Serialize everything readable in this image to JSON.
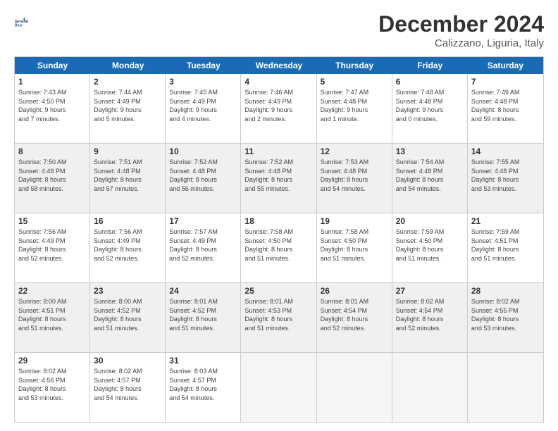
{
  "header": {
    "logo_general": "General",
    "logo_blue": "Blue",
    "month_title": "December 2024",
    "location": "Calizzano, Liguria, Italy"
  },
  "weekdays": [
    "Sunday",
    "Monday",
    "Tuesday",
    "Wednesday",
    "Thursday",
    "Friday",
    "Saturday"
  ],
  "weeks": [
    [
      {
        "day": "1",
        "info": "Sunrise: 7:43 AM\nSunset: 4:50 PM\nDaylight: 9 hours\nand 7 minutes.",
        "empty": false,
        "shaded": false
      },
      {
        "day": "2",
        "info": "Sunrise: 7:44 AM\nSunset: 4:49 PM\nDaylight: 9 hours\nand 5 minutes.",
        "empty": false,
        "shaded": false
      },
      {
        "day": "3",
        "info": "Sunrise: 7:45 AM\nSunset: 4:49 PM\nDaylight: 9 hours\nand 4 minutes.",
        "empty": false,
        "shaded": false
      },
      {
        "day": "4",
        "info": "Sunrise: 7:46 AM\nSunset: 4:49 PM\nDaylight: 9 hours\nand 2 minutes.",
        "empty": false,
        "shaded": false
      },
      {
        "day": "5",
        "info": "Sunrise: 7:47 AM\nSunset: 4:48 PM\nDaylight: 9 hours\nand 1 minute.",
        "empty": false,
        "shaded": false
      },
      {
        "day": "6",
        "info": "Sunrise: 7:48 AM\nSunset: 4:48 PM\nDaylight: 9 hours\nand 0 minutes.",
        "empty": false,
        "shaded": false
      },
      {
        "day": "7",
        "info": "Sunrise: 7:49 AM\nSunset: 4:48 PM\nDaylight: 8 hours\nand 59 minutes.",
        "empty": false,
        "shaded": false
      }
    ],
    [
      {
        "day": "8",
        "info": "Sunrise: 7:50 AM\nSunset: 4:48 PM\nDaylight: 8 hours\nand 58 minutes.",
        "empty": false,
        "shaded": true
      },
      {
        "day": "9",
        "info": "Sunrise: 7:51 AM\nSunset: 4:48 PM\nDaylight: 8 hours\nand 57 minutes.",
        "empty": false,
        "shaded": true
      },
      {
        "day": "10",
        "info": "Sunrise: 7:52 AM\nSunset: 4:48 PM\nDaylight: 8 hours\nand 56 minutes.",
        "empty": false,
        "shaded": true
      },
      {
        "day": "11",
        "info": "Sunrise: 7:52 AM\nSunset: 4:48 PM\nDaylight: 8 hours\nand 55 minutes.",
        "empty": false,
        "shaded": true
      },
      {
        "day": "12",
        "info": "Sunrise: 7:53 AM\nSunset: 4:48 PM\nDaylight: 8 hours\nand 54 minutes.",
        "empty": false,
        "shaded": true
      },
      {
        "day": "13",
        "info": "Sunrise: 7:54 AM\nSunset: 4:48 PM\nDaylight: 8 hours\nand 54 minutes.",
        "empty": false,
        "shaded": true
      },
      {
        "day": "14",
        "info": "Sunrise: 7:55 AM\nSunset: 4:48 PM\nDaylight: 8 hours\nand 53 minutes.",
        "empty": false,
        "shaded": true
      }
    ],
    [
      {
        "day": "15",
        "info": "Sunrise: 7:56 AM\nSunset: 4:49 PM\nDaylight: 8 hours\nand 52 minutes.",
        "empty": false,
        "shaded": false
      },
      {
        "day": "16",
        "info": "Sunrise: 7:56 AM\nSunset: 4:49 PM\nDaylight: 8 hours\nand 52 minutes.",
        "empty": false,
        "shaded": false
      },
      {
        "day": "17",
        "info": "Sunrise: 7:57 AM\nSunset: 4:49 PM\nDaylight: 8 hours\nand 52 minutes.",
        "empty": false,
        "shaded": false
      },
      {
        "day": "18",
        "info": "Sunrise: 7:58 AM\nSunset: 4:50 PM\nDaylight: 8 hours\nand 51 minutes.",
        "empty": false,
        "shaded": false
      },
      {
        "day": "19",
        "info": "Sunrise: 7:58 AM\nSunset: 4:50 PM\nDaylight: 8 hours\nand 51 minutes.",
        "empty": false,
        "shaded": false
      },
      {
        "day": "20",
        "info": "Sunrise: 7:59 AM\nSunset: 4:50 PM\nDaylight: 8 hours\nand 51 minutes.",
        "empty": false,
        "shaded": false
      },
      {
        "day": "21",
        "info": "Sunrise: 7:59 AM\nSunset: 4:51 PM\nDaylight: 8 hours\nand 51 minutes.",
        "empty": false,
        "shaded": false
      }
    ],
    [
      {
        "day": "22",
        "info": "Sunrise: 8:00 AM\nSunset: 4:51 PM\nDaylight: 8 hours\nand 51 minutes.",
        "empty": false,
        "shaded": true
      },
      {
        "day": "23",
        "info": "Sunrise: 8:00 AM\nSunset: 4:52 PM\nDaylight: 8 hours\nand 51 minutes.",
        "empty": false,
        "shaded": true
      },
      {
        "day": "24",
        "info": "Sunrise: 8:01 AM\nSunset: 4:52 PM\nDaylight: 8 hours\nand 51 minutes.",
        "empty": false,
        "shaded": true
      },
      {
        "day": "25",
        "info": "Sunrise: 8:01 AM\nSunset: 4:53 PM\nDaylight: 8 hours\nand 51 minutes.",
        "empty": false,
        "shaded": true
      },
      {
        "day": "26",
        "info": "Sunrise: 8:01 AM\nSunset: 4:54 PM\nDaylight: 8 hours\nand 52 minutes.",
        "empty": false,
        "shaded": true
      },
      {
        "day": "27",
        "info": "Sunrise: 8:02 AM\nSunset: 4:54 PM\nDaylight: 8 hours\nand 52 minutes.",
        "empty": false,
        "shaded": true
      },
      {
        "day": "28",
        "info": "Sunrise: 8:02 AM\nSunset: 4:55 PM\nDaylight: 8 hours\nand 53 minutes.",
        "empty": false,
        "shaded": true
      }
    ],
    [
      {
        "day": "29",
        "info": "Sunrise: 8:02 AM\nSunset: 4:56 PM\nDaylight: 8 hours\nand 53 minutes.",
        "empty": false,
        "shaded": false
      },
      {
        "day": "30",
        "info": "Sunrise: 8:02 AM\nSunset: 4:57 PM\nDaylight: 8 hours\nand 54 minutes.",
        "empty": false,
        "shaded": false
      },
      {
        "day": "31",
        "info": "Sunrise: 8:03 AM\nSunset: 4:57 PM\nDaylight: 8 hours\nand 54 minutes.",
        "empty": false,
        "shaded": false
      },
      {
        "day": "",
        "info": "",
        "empty": true,
        "shaded": false
      },
      {
        "day": "",
        "info": "",
        "empty": true,
        "shaded": false
      },
      {
        "day": "",
        "info": "",
        "empty": true,
        "shaded": false
      },
      {
        "day": "",
        "info": "",
        "empty": true,
        "shaded": false
      }
    ]
  ]
}
